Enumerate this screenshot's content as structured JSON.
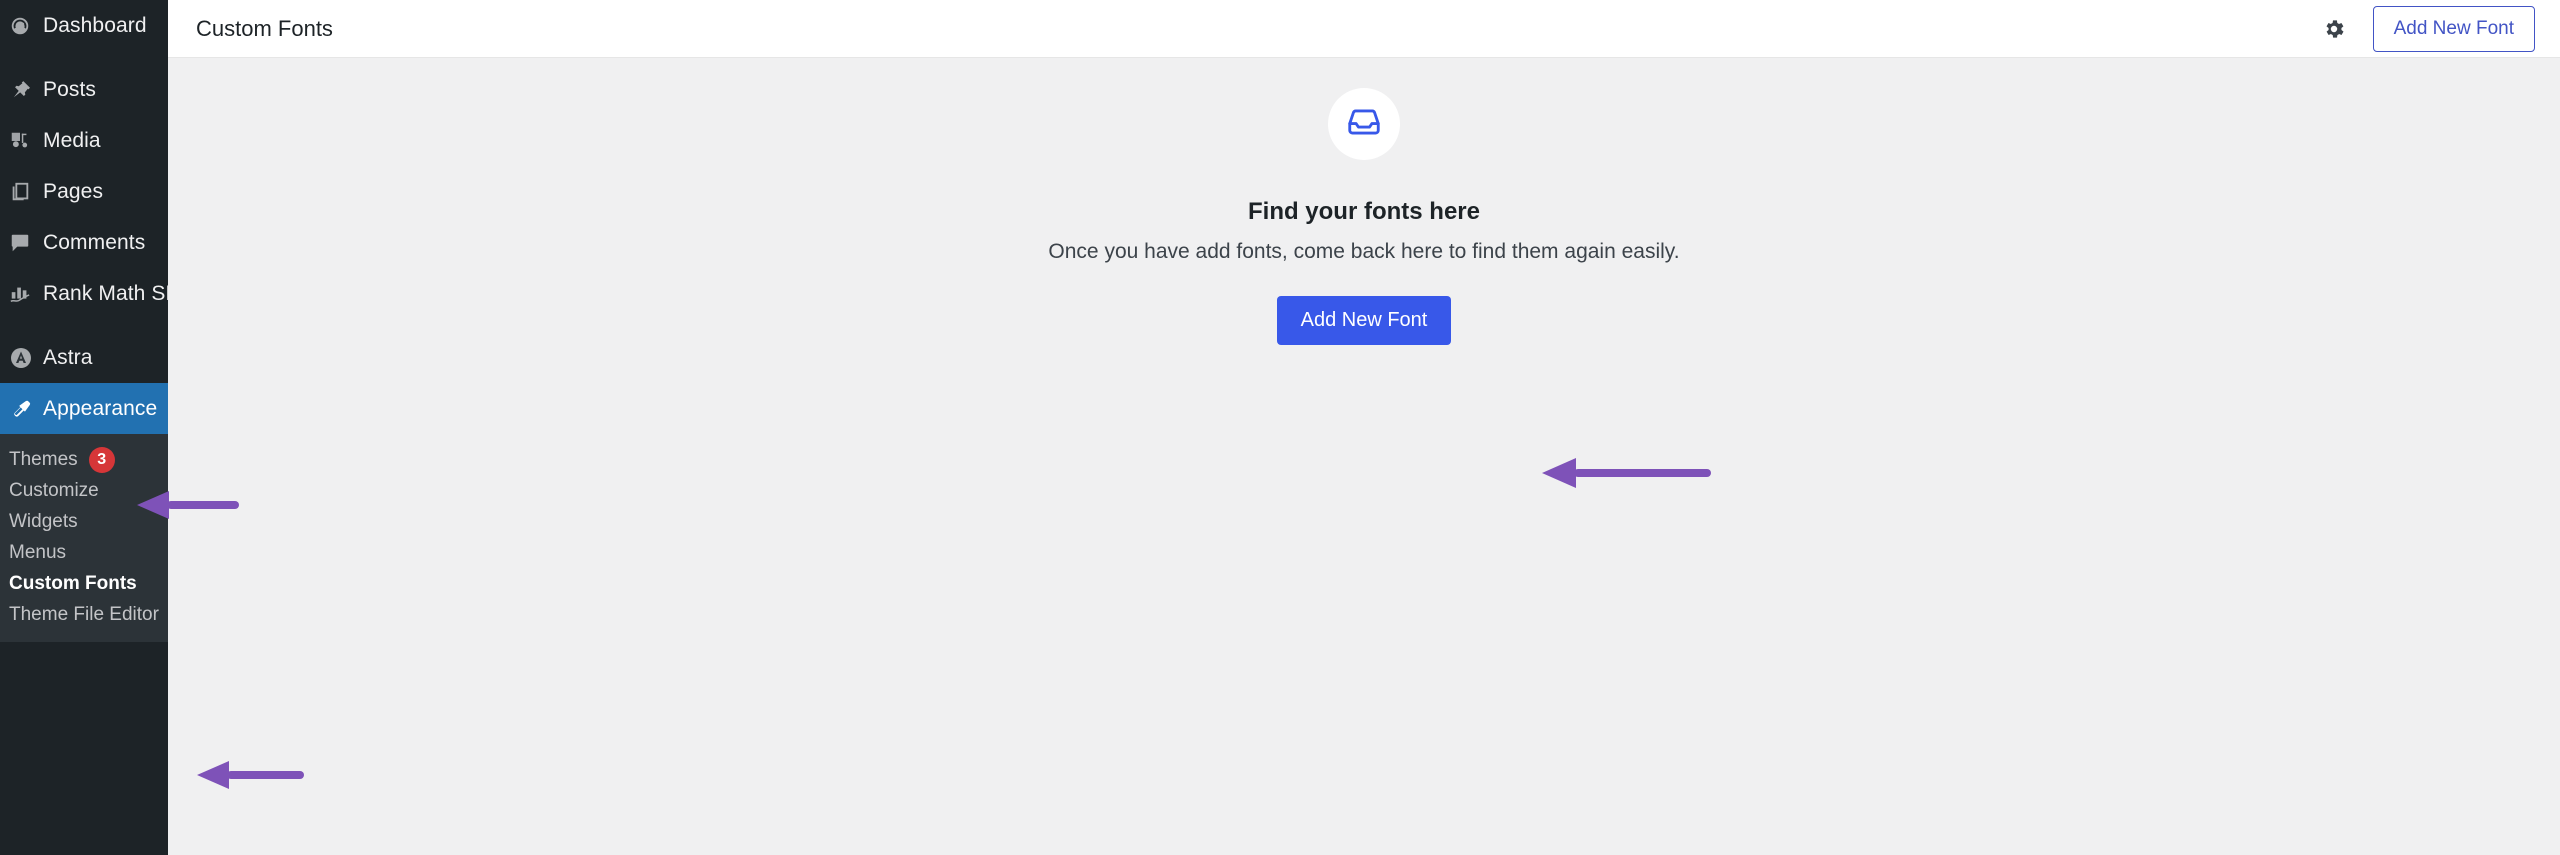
{
  "sidebar": {
    "items": [
      {
        "label": "Dashboard",
        "icon": "dashboard-icon",
        "active": false
      },
      {
        "label": "Posts",
        "icon": "pin-icon",
        "active": false
      },
      {
        "label": "Media",
        "icon": "media-icon",
        "active": false
      },
      {
        "label": "Pages",
        "icon": "pages-icon",
        "active": false
      },
      {
        "label": "Comments",
        "icon": "comments-icon",
        "active": false
      },
      {
        "label": "Rank Math SEO",
        "icon": "rank-math-icon",
        "active": false
      },
      {
        "label": "Astra",
        "icon": "astra-icon",
        "active": false
      },
      {
        "label": "Appearance",
        "icon": "paintbrush-icon",
        "active": true
      }
    ],
    "submenu": [
      {
        "label": "Themes",
        "badge": "3",
        "current": false
      },
      {
        "label": "Customize",
        "badge": "",
        "current": false
      },
      {
        "label": "Widgets",
        "badge": "",
        "current": false
      },
      {
        "label": "Menus",
        "badge": "",
        "current": false
      },
      {
        "label": "Custom Fonts",
        "badge": "",
        "current": true
      },
      {
        "label": "Theme File Editor",
        "badge": "",
        "current": false
      }
    ]
  },
  "topbar": {
    "title": "Custom Fonts",
    "settings_icon": "gear-icon",
    "add_font_label": "Add New Font"
  },
  "empty_state": {
    "icon": "inbox-icon",
    "title": "Find your fonts here",
    "description": "Once you have add fonts, come back here to find them again easily.",
    "button_label": "Add New Font"
  },
  "colors": {
    "sidebar_bg": "#1d2327",
    "submenu_bg": "#2c3338",
    "active_menu": "#2271b1",
    "primary_button": "#3858e9",
    "outline_button": "#4254c5",
    "badge": "#d63638",
    "annotation_arrow": "#7e52b8",
    "content_bg": "#f0f0f1"
  },
  "annotations": [
    {
      "name": "arrow-to-appearance",
      "target": "Appearance"
    },
    {
      "name": "arrow-to-custom-fonts",
      "target": "Custom Fonts"
    },
    {
      "name": "arrow-to-add-new-font",
      "target": "Add New Font"
    }
  ]
}
